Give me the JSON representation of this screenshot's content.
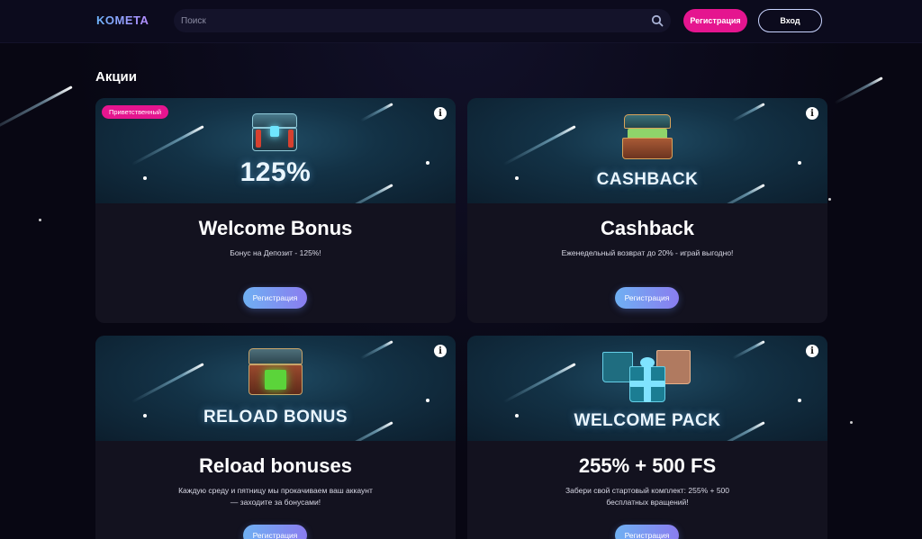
{
  "header": {
    "logo": "KOMETA",
    "search_placeholder": "Поиск",
    "register_label": "Регистрация",
    "login_label": "Вход"
  },
  "section_title": "Акции",
  "promos": [
    {
      "badge": "Приветственный",
      "banner_text": "125%",
      "title": "Welcome Bonus",
      "description": "Бонус на Депозит - 125%!",
      "button_label": "Регистрация"
    },
    {
      "banner_text": "CASHBACK",
      "title": "Cashback",
      "description": "Еженедельный возврат до 20% - играй выгодно!",
      "button_label": "Регистрация"
    },
    {
      "banner_text": "RELOAD BONUS",
      "title": "Reload bonuses",
      "description": "Каждую среду и пятницу мы прокачиваем ваш аккаунт — заходите за бонусами!",
      "button_label": "Регистрация"
    },
    {
      "banner_text": "WELCOME PACK",
      "title": "255% + 500 FS",
      "description": "Забери свой стартовый комплект: 255% + 500 бесплатных вращений!",
      "button_label": "Регистрация"
    }
  ],
  "icons": {
    "search": "search-icon",
    "info": "info-icon"
  },
  "colors": {
    "accent_pink": "#e5158f",
    "button_gradient_start": "#6fb0f2",
    "button_gradient_end": "#8a7df0",
    "background": "#080713",
    "card": "#13121f"
  }
}
